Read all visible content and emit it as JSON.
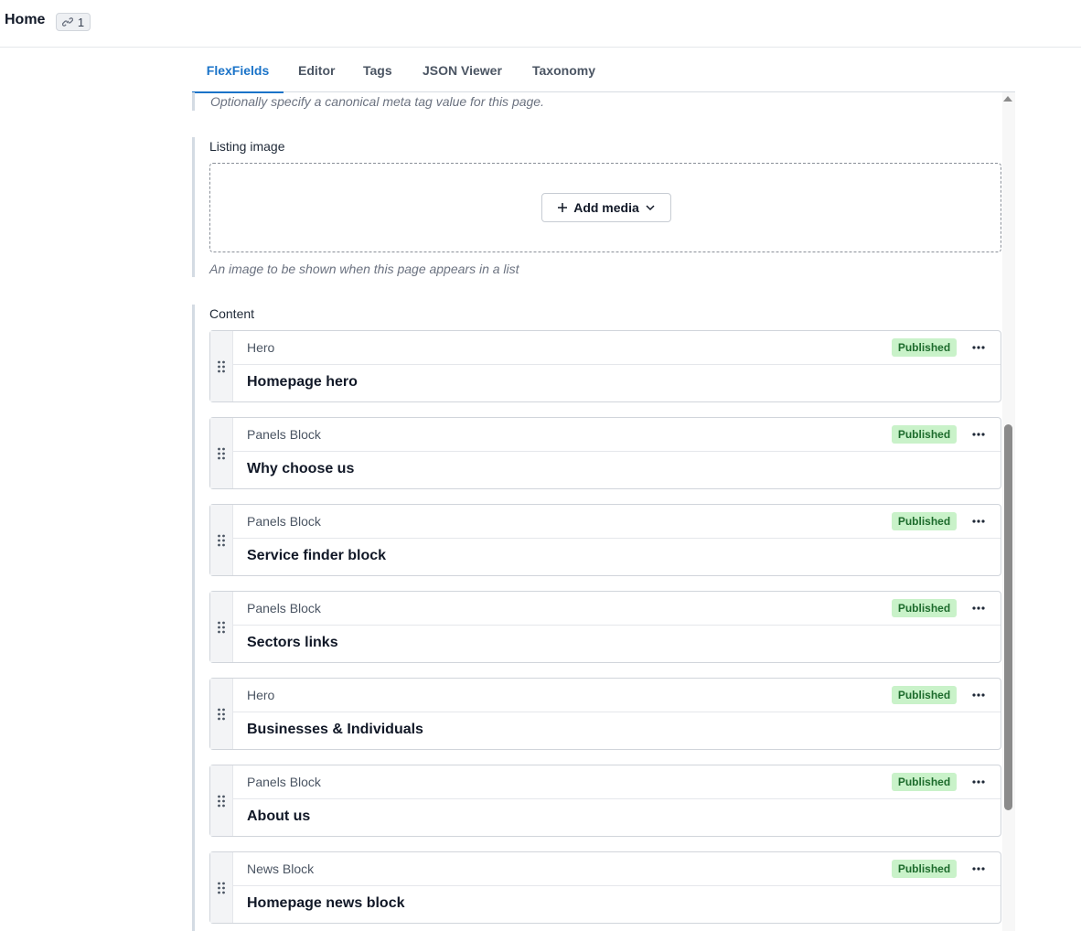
{
  "header": {
    "title": "Home",
    "link_count": "1"
  },
  "tabs": [
    {
      "label": "FlexFields",
      "active": true
    },
    {
      "label": "Editor"
    },
    {
      "label": "Tags"
    },
    {
      "label": "JSON Viewer"
    },
    {
      "label": "Taxonomy"
    }
  ],
  "fields": {
    "canonical_help": "Optionally specify a canonical meta tag value for this page.",
    "listing_image": {
      "label": "Listing image",
      "add_media_label": "Add media",
      "help": "An image to be shown when this page appears in a list"
    },
    "content": {
      "label": "Content",
      "blocks": [
        {
          "type": "Hero",
          "title": "Homepage hero",
          "status": "Published"
        },
        {
          "type": "Panels Block",
          "title": "Why choose us",
          "status": "Published"
        },
        {
          "type": "Panels Block",
          "title": "Service finder block",
          "status": "Published"
        },
        {
          "type": "Panels Block",
          "title": "Sectors links",
          "status": "Published"
        },
        {
          "type": "Hero",
          "title": "Businesses & Individuals",
          "status": "Published"
        },
        {
          "type": "Panels Block",
          "title": "About us",
          "status": "Published"
        },
        {
          "type": "News Block",
          "title": "Homepage news block",
          "status": "Published"
        }
      ]
    }
  },
  "colors": {
    "accent": "#1a73c8",
    "published_bg": "#c9f2c9",
    "published_text": "#1d6b2c"
  },
  "icons": [
    "link-icon",
    "plus-icon",
    "chevron-down-icon",
    "drag-handle-icon",
    "more-icon"
  ]
}
